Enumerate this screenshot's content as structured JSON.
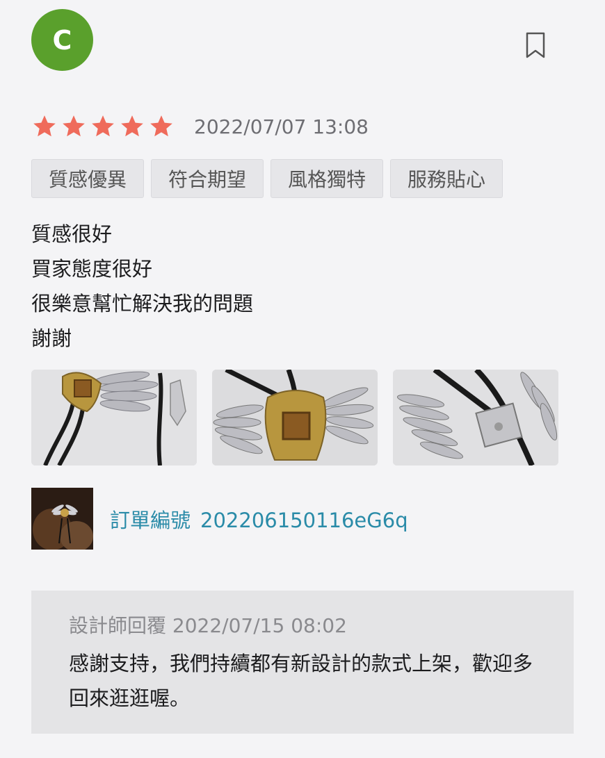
{
  "reviewer": {
    "avatar_letter": "C",
    "avatar_color": "#5aa02c"
  },
  "bookmark_icon": "bookmark-icon",
  "rating": {
    "stars": 5,
    "star_color": "#ef6b5b",
    "timestamp": "2022/07/07 13:08"
  },
  "tags": [
    "質感優異",
    "符合期望",
    "風格獨特",
    "服務貼心"
  ],
  "review": {
    "lines": [
      "質感很好",
      "買家態度很好",
      "很樂意幫忙解決我的問題",
      "謝謝"
    ]
  },
  "order": {
    "label": "訂單編號",
    "number": "202206150116eG6q",
    "link_color": "#2a8ba8"
  },
  "reply": {
    "author": "設計師回覆",
    "timestamp": "2022/07/15 08:02",
    "text": "感謝支持，我們持續都有新設計的款式上架，歡迎多回來逛逛喔。"
  }
}
